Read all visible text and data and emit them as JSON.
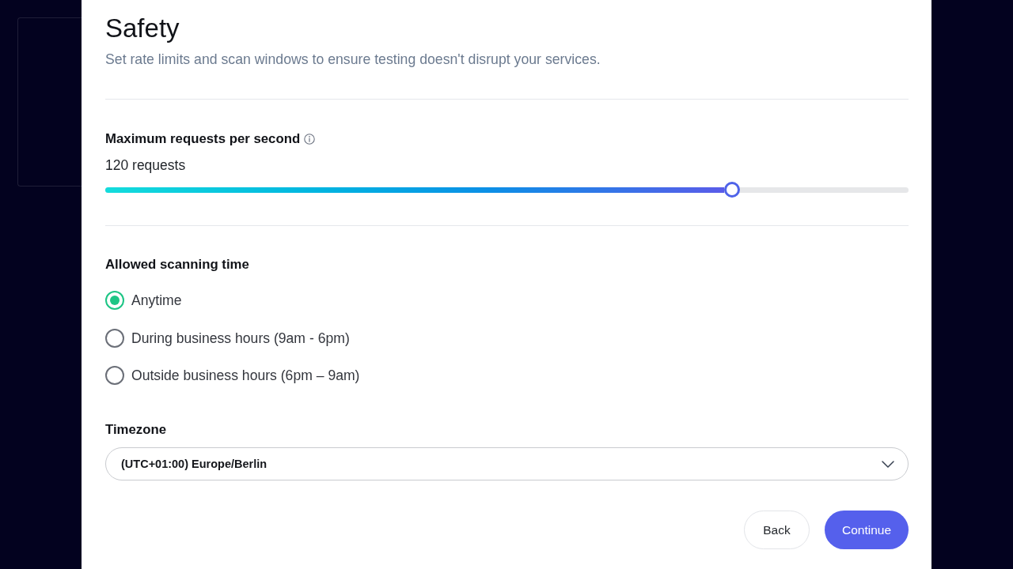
{
  "panel": {
    "title": "Safety",
    "subtitle": "Set rate limits and scan windows to ensure testing doesn't disrupt your services."
  },
  "rate_limit": {
    "label": "Maximum requests per second",
    "reading": "120 requests",
    "level": 0.78
  },
  "scan_time": {
    "label": "Allowed scanning time",
    "options": [
      {
        "label": "Anytime",
        "selected": true
      },
      {
        "label": "During business hours (9am - 6pm)",
        "selected": false
      },
      {
        "label": "Outside business hours (6pm – 9am)",
        "selected": false
      }
    ]
  },
  "timezone": {
    "label": "Timezone",
    "value": "(UTC+01:00) Europe/Berlin"
  },
  "buttons": [
    {
      "label": "Back",
      "kind": "secondary"
    },
    {
      "label": "Continue",
      "kind": "primary"
    }
  ]
}
